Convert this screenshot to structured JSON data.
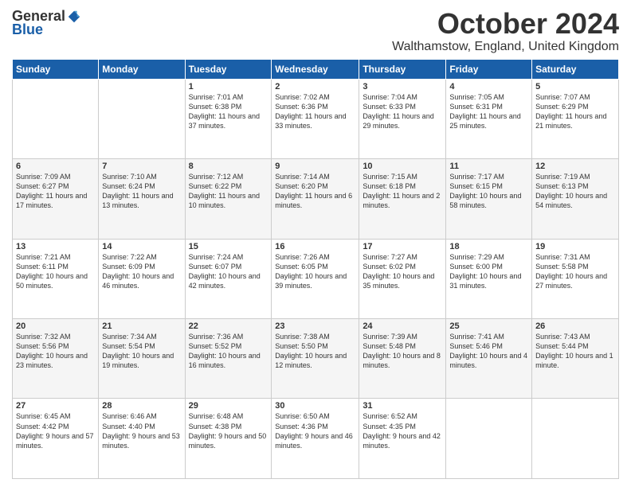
{
  "logo": {
    "general": "General",
    "blue": "Blue"
  },
  "title": "October 2024",
  "location": "Walthamstow, England, United Kingdom",
  "days_of_week": [
    "Sunday",
    "Monday",
    "Tuesday",
    "Wednesday",
    "Thursday",
    "Friday",
    "Saturday"
  ],
  "weeks": [
    [
      {
        "day": "",
        "info": ""
      },
      {
        "day": "",
        "info": ""
      },
      {
        "day": "1",
        "info": "Sunrise: 7:01 AM\nSunset: 6:38 PM\nDaylight: 11 hours and 37 minutes."
      },
      {
        "day": "2",
        "info": "Sunrise: 7:02 AM\nSunset: 6:36 PM\nDaylight: 11 hours and 33 minutes."
      },
      {
        "day": "3",
        "info": "Sunrise: 7:04 AM\nSunset: 6:33 PM\nDaylight: 11 hours and 29 minutes."
      },
      {
        "day": "4",
        "info": "Sunrise: 7:05 AM\nSunset: 6:31 PM\nDaylight: 11 hours and 25 minutes."
      },
      {
        "day": "5",
        "info": "Sunrise: 7:07 AM\nSunset: 6:29 PM\nDaylight: 11 hours and 21 minutes."
      }
    ],
    [
      {
        "day": "6",
        "info": "Sunrise: 7:09 AM\nSunset: 6:27 PM\nDaylight: 11 hours and 17 minutes."
      },
      {
        "day": "7",
        "info": "Sunrise: 7:10 AM\nSunset: 6:24 PM\nDaylight: 11 hours and 13 minutes."
      },
      {
        "day": "8",
        "info": "Sunrise: 7:12 AM\nSunset: 6:22 PM\nDaylight: 11 hours and 10 minutes."
      },
      {
        "day": "9",
        "info": "Sunrise: 7:14 AM\nSunset: 6:20 PM\nDaylight: 11 hours and 6 minutes."
      },
      {
        "day": "10",
        "info": "Sunrise: 7:15 AM\nSunset: 6:18 PM\nDaylight: 11 hours and 2 minutes."
      },
      {
        "day": "11",
        "info": "Sunrise: 7:17 AM\nSunset: 6:15 PM\nDaylight: 10 hours and 58 minutes."
      },
      {
        "day": "12",
        "info": "Sunrise: 7:19 AM\nSunset: 6:13 PM\nDaylight: 10 hours and 54 minutes."
      }
    ],
    [
      {
        "day": "13",
        "info": "Sunrise: 7:21 AM\nSunset: 6:11 PM\nDaylight: 10 hours and 50 minutes."
      },
      {
        "day": "14",
        "info": "Sunrise: 7:22 AM\nSunset: 6:09 PM\nDaylight: 10 hours and 46 minutes."
      },
      {
        "day": "15",
        "info": "Sunrise: 7:24 AM\nSunset: 6:07 PM\nDaylight: 10 hours and 42 minutes."
      },
      {
        "day": "16",
        "info": "Sunrise: 7:26 AM\nSunset: 6:05 PM\nDaylight: 10 hours and 39 minutes."
      },
      {
        "day": "17",
        "info": "Sunrise: 7:27 AM\nSunset: 6:02 PM\nDaylight: 10 hours and 35 minutes."
      },
      {
        "day": "18",
        "info": "Sunrise: 7:29 AM\nSunset: 6:00 PM\nDaylight: 10 hours and 31 minutes."
      },
      {
        "day": "19",
        "info": "Sunrise: 7:31 AM\nSunset: 5:58 PM\nDaylight: 10 hours and 27 minutes."
      }
    ],
    [
      {
        "day": "20",
        "info": "Sunrise: 7:32 AM\nSunset: 5:56 PM\nDaylight: 10 hours and 23 minutes."
      },
      {
        "day": "21",
        "info": "Sunrise: 7:34 AM\nSunset: 5:54 PM\nDaylight: 10 hours and 19 minutes."
      },
      {
        "day": "22",
        "info": "Sunrise: 7:36 AM\nSunset: 5:52 PM\nDaylight: 10 hours and 16 minutes."
      },
      {
        "day": "23",
        "info": "Sunrise: 7:38 AM\nSunset: 5:50 PM\nDaylight: 10 hours and 12 minutes."
      },
      {
        "day": "24",
        "info": "Sunrise: 7:39 AM\nSunset: 5:48 PM\nDaylight: 10 hours and 8 minutes."
      },
      {
        "day": "25",
        "info": "Sunrise: 7:41 AM\nSunset: 5:46 PM\nDaylight: 10 hours and 4 minutes."
      },
      {
        "day": "26",
        "info": "Sunrise: 7:43 AM\nSunset: 5:44 PM\nDaylight: 10 hours and 1 minute."
      }
    ],
    [
      {
        "day": "27",
        "info": "Sunrise: 6:45 AM\nSunset: 4:42 PM\nDaylight: 9 hours and 57 minutes."
      },
      {
        "day": "28",
        "info": "Sunrise: 6:46 AM\nSunset: 4:40 PM\nDaylight: 9 hours and 53 minutes."
      },
      {
        "day": "29",
        "info": "Sunrise: 6:48 AM\nSunset: 4:38 PM\nDaylight: 9 hours and 50 minutes."
      },
      {
        "day": "30",
        "info": "Sunrise: 6:50 AM\nSunset: 4:36 PM\nDaylight: 9 hours and 46 minutes."
      },
      {
        "day": "31",
        "info": "Sunrise: 6:52 AM\nSunset: 4:35 PM\nDaylight: 9 hours and 42 minutes."
      },
      {
        "day": "",
        "info": ""
      },
      {
        "day": "",
        "info": ""
      }
    ]
  ]
}
